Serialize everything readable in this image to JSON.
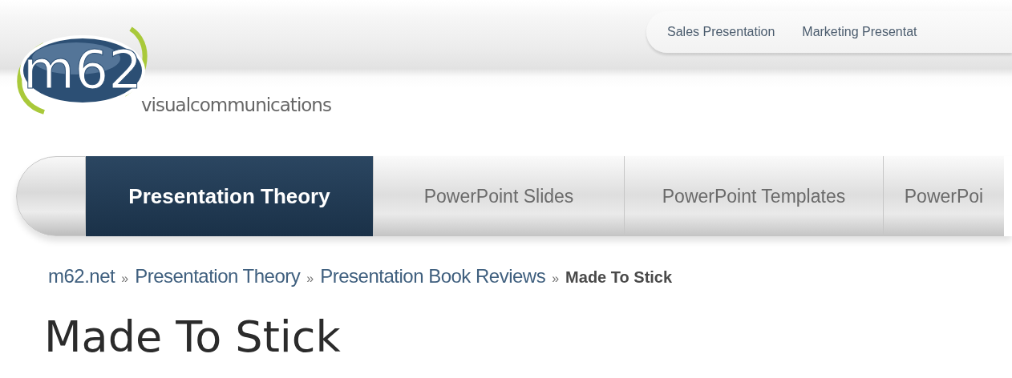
{
  "logo": {
    "mark": "m62",
    "tagline": "visualcommunications"
  },
  "top_links": [
    {
      "label": "Sales Presentation"
    },
    {
      "label": "Marketing Presentat"
    }
  ],
  "nav_tabs": [
    {
      "label": "Presentation Theory",
      "selected": true
    },
    {
      "label": "PowerPoint Slides",
      "selected": false
    },
    {
      "label": "PowerPoint Templates",
      "selected": false
    },
    {
      "label": "PowerPoi",
      "selected": false
    }
  ],
  "breadcrumb": [
    {
      "kind": "link",
      "label": "m62.net"
    },
    {
      "kind": "separator",
      "label": "»"
    },
    {
      "kind": "link",
      "label": "Presentation Theory"
    },
    {
      "kind": "separator",
      "label": "»"
    },
    {
      "kind": "link",
      "label": "Presentation Book Reviews"
    },
    {
      "kind": "separator",
      "label": "»"
    },
    {
      "kind": "current",
      "label": "Made To Stick"
    }
  ],
  "page_title": "Made To Stick"
}
